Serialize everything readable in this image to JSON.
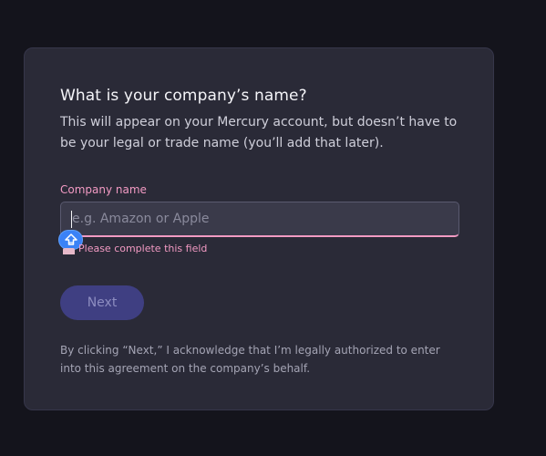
{
  "form": {
    "title": "What is your company’s name?",
    "subtitle": "This will appear on your Mercury account, but doesn’t have to be your legal or trade name (you’ll add that later).",
    "field_label": "Company name",
    "input_value": "",
    "input_placeholder": "e.g. Amazon or Apple",
    "error_message": "Please complete this field",
    "next_label": "Next",
    "legal_text": "By clicking “Next,” I acknowledge that I’m legally authorized to enter into this agreement on the company’s behalf."
  },
  "icons": {
    "upload": "upload-arrow-icon",
    "warning": "warning-icon"
  },
  "colors": {
    "page_bg": "#14141c",
    "card_bg": "#2a2a37",
    "error_pink": "#f29ac3",
    "button_bg": "#3f3f82",
    "icon_blue": "#3b82f6"
  }
}
